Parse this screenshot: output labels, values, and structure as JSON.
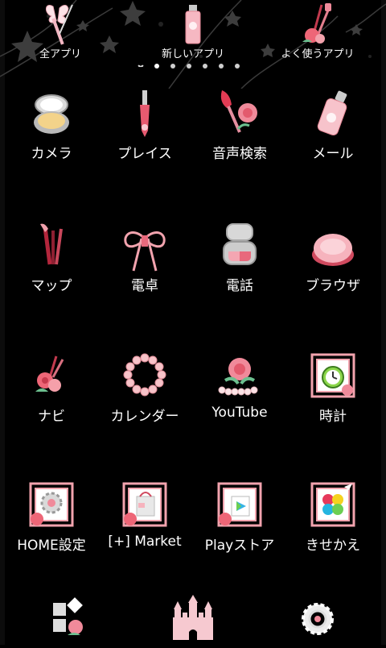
{
  "tabs": [
    {
      "label": "全アプリ",
      "icon": "butterfly-pen-icon"
    },
    {
      "label": "新しいアプリ",
      "icon": "perfume-bottle-icon"
    },
    {
      "label": "よく使うアプリ",
      "icon": "rose-brushes-icon"
    }
  ],
  "page_indicator": {
    "total": 7,
    "current": 1
  },
  "apps": [
    {
      "label": "カメラ",
      "icon": "compact-powder-icon"
    },
    {
      "label": "プレイス",
      "icon": "lip-brush-icon"
    },
    {
      "label": "音声検索",
      "icon": "brush-rose-icon"
    },
    {
      "label": "メール",
      "icon": "lotion-bottle-icon"
    },
    {
      "label": "マップ",
      "icon": "makeup-brushes-icon"
    },
    {
      "label": "電卓",
      "icon": "ribbon-bow-icon"
    },
    {
      "label": "電話",
      "icon": "heart-compact-icon"
    },
    {
      "label": "ブラウザ",
      "icon": "powder-puff-icon"
    },
    {
      "label": "ナビ",
      "icon": "rose-bouquet-icon"
    },
    {
      "label": "カレンダー",
      "icon": "pearl-bracelet-icon"
    },
    {
      "label": "YouTube",
      "icon": "rose-pearls-icon"
    },
    {
      "label": "時計",
      "icon": "alarm-clock-icon"
    },
    {
      "label": "HOME設定",
      "icon": "gear-frame-icon"
    },
    {
      "label": "[+] Market",
      "icon": "shopping-bag-frame-icon"
    },
    {
      "label": "Playストア",
      "icon": "play-bag-frame-icon"
    },
    {
      "label": "きせかえ",
      "icon": "palette-frame-icon"
    }
  ],
  "dock": [
    {
      "name": "widgets-icon"
    },
    {
      "name": "castle-icon"
    },
    {
      "name": "settings-icon"
    }
  ],
  "colors": {
    "background": "#000000",
    "accent_pink": "#f08a9a",
    "text": "#ffffff"
  }
}
